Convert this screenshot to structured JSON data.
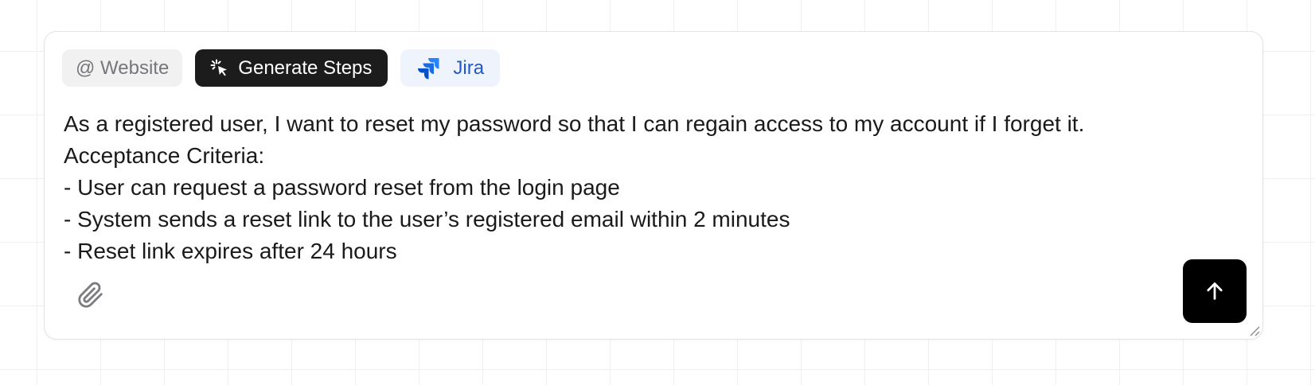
{
  "toolbar": {
    "website_chip": {
      "label": "@ Website",
      "icon": "at-icon"
    },
    "generate_chip": {
      "label": "Generate Steps",
      "icon": "cursor-click-icon"
    },
    "jira_chip": {
      "label": "Jira",
      "icon": "jira-logo-icon"
    }
  },
  "story": {
    "lines": [
      "As a registered user, I want to reset my password so that I can regain access to my account if I forget it.",
      "Acceptance Criteria:",
      "- User can request a password reset from the login page",
      "- System sends a reset link to the user’s registered email within 2 minutes",
      "- Reset link expires after 24 hours"
    ]
  },
  "actions": {
    "attach_icon": "paperclip-icon",
    "send_icon": "arrow-up-icon"
  },
  "colors": {
    "generate_chip_bg": "#1c1c1c",
    "jira_text": "#2259c9",
    "jira_chip_bg": "#eef3fc",
    "send_button_bg": "#000000"
  }
}
